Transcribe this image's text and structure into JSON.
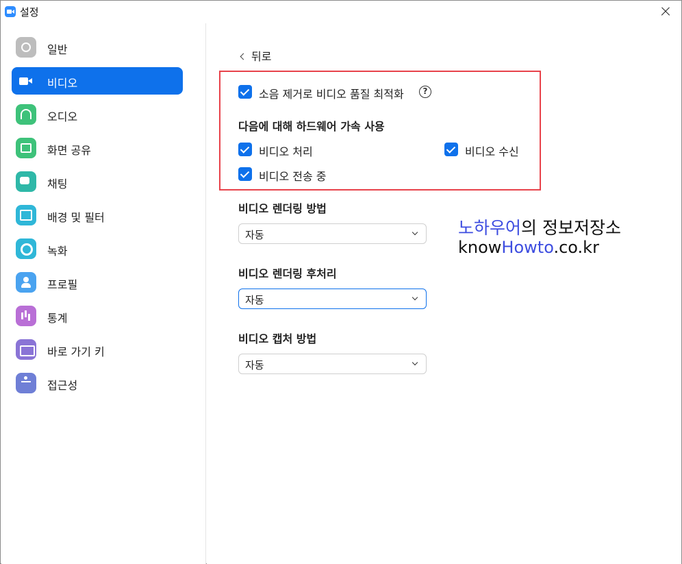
{
  "window": {
    "title": "설정"
  },
  "sidebar": {
    "items": [
      {
        "label": "일반",
        "icon": "gear-icon",
        "active": false
      },
      {
        "label": "비디오",
        "icon": "video-camera-icon",
        "active": true
      },
      {
        "label": "오디오",
        "icon": "headphones-icon",
        "active": false
      },
      {
        "label": "화면 공유",
        "icon": "screen-share-icon",
        "active": false
      },
      {
        "label": "채팅",
        "icon": "chat-icon",
        "active": false
      },
      {
        "label": "배경 및 필터",
        "icon": "background-icon",
        "active": false
      },
      {
        "label": "녹화",
        "icon": "record-icon",
        "active": false
      },
      {
        "label": "프로필",
        "icon": "profile-icon",
        "active": false
      },
      {
        "label": "통계",
        "icon": "statistics-icon",
        "active": false
      },
      {
        "label": "바로 가기 키",
        "icon": "keyboard-icon",
        "active": false
      },
      {
        "label": "접근성",
        "icon": "accessibility-icon",
        "active": false
      }
    ]
  },
  "main": {
    "back_label": "뒤로",
    "noise_option": {
      "label": "소음 제거로 비디오 품질 최적화",
      "checked": true
    },
    "hw_accel": {
      "title": "다음에 대해 하드웨어 가속 사용",
      "processing": {
        "label": "비디오 처리",
        "checked": true
      },
      "receiving": {
        "label": "비디오 수신",
        "checked": true
      },
      "sending": {
        "label": "비디오 전송 중",
        "checked": true
      }
    },
    "rendering_method": {
      "title": "비디오 렌더링 방법",
      "value": "자동"
    },
    "rendering_post": {
      "title": "비디오 렌더링 후처리",
      "value": "자동"
    },
    "capture_method": {
      "title": "비디오 캡처 방법",
      "value": "자동"
    }
  },
  "watermark": {
    "line1_blue": "노하우어",
    "line1_rest": "의 정보저장소",
    "line2_pre": "know",
    "line2_blue": "Howto",
    "line2_post": ".co.kr"
  },
  "colors": {
    "accent": "#0e71eb",
    "highlight_box": "#e8424a",
    "watermark_blue": "#3d4de0"
  }
}
